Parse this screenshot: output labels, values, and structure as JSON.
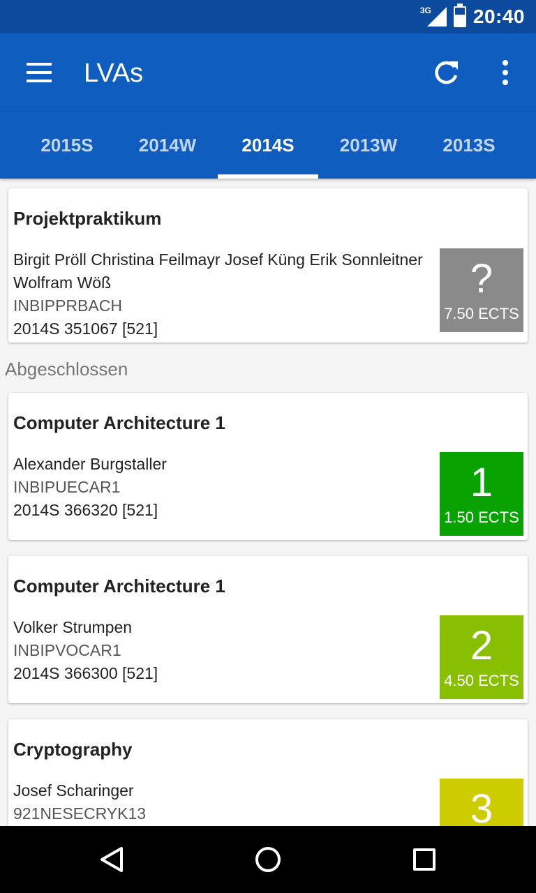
{
  "status": {
    "time": "20:40",
    "network": "3G"
  },
  "appbar": {
    "title": "LVAs"
  },
  "tabs": [
    {
      "label": "2015S"
    },
    {
      "label": "2014W"
    },
    {
      "label": "2014S",
      "active": true
    },
    {
      "label": "2013W"
    },
    {
      "label": "2013S"
    }
  ],
  "section_label": "Abgeschlossen",
  "courses": [
    {
      "title": "Projektpraktikum",
      "lecturers_line1": "Birgit Pröll Christina Feilmayr Josef Küng Erik Sonnleitner",
      "lecturers_line2": "Wolfram Wöß",
      "code": "INBIPPRBACH",
      "term": "2014S 351067 [521]",
      "grade": "?",
      "ects": "7.50 ECTS",
      "color": "#8a8a8a"
    },
    {
      "title": "Computer Architecture 1",
      "lecturers_line1": "Alexander Burgstaller",
      "code": "INBIPUECAR1",
      "term": "2014S 366320 [521]",
      "grade": "1",
      "ects": "1.50 ECTS",
      "color": "#08a300"
    },
    {
      "title": "Computer Architecture 1",
      "lecturers_line1": "Volker Strumpen",
      "code": "INBIPVOCAR1",
      "term": "2014S 366300 [521]",
      "grade": "2",
      "ects": "4.50 ECTS",
      "color": "#88bf00"
    },
    {
      "title": "Cryptography",
      "lecturers_line1": "Josef Scharinger",
      "code": "921NESECRYK13",
      "grade": "3",
      "color": "#cccc00"
    }
  ]
}
